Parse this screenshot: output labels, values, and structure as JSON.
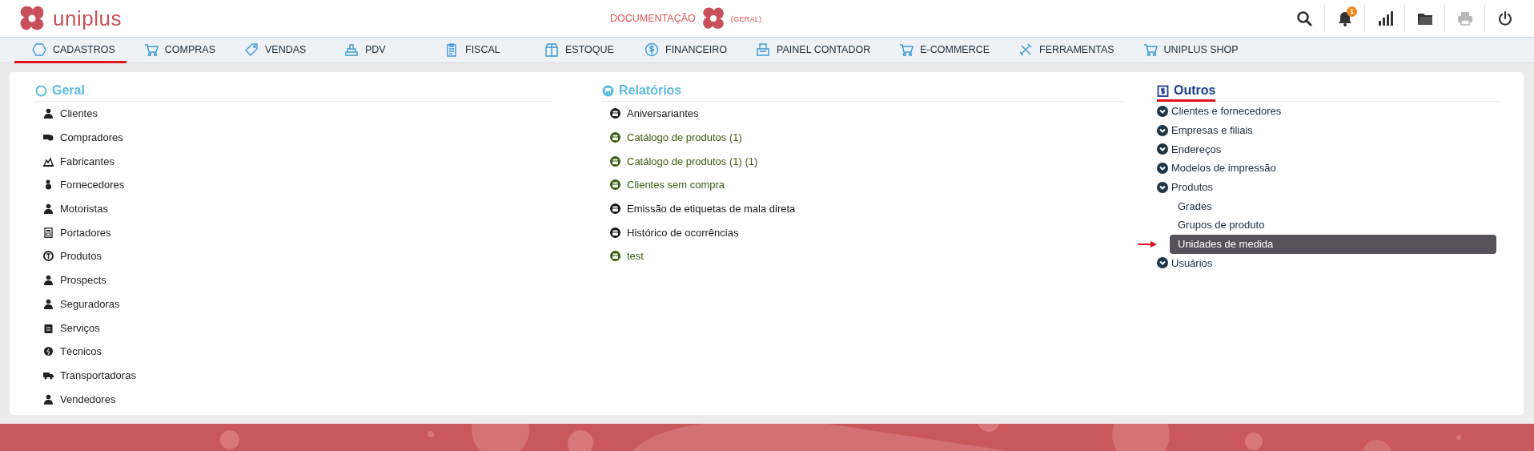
{
  "header": {
    "logo_text": "uniplus",
    "context_label": "DOCUMENTAÇÃO",
    "context_scope": "(GERAL)",
    "toolbar": [
      {
        "kind": "search",
        "disabled": false
      },
      {
        "kind": "notifications",
        "disabled": false,
        "badge": "1"
      },
      {
        "kind": "charts",
        "disabled": false
      },
      {
        "kind": "folder",
        "disabled": false
      },
      {
        "kind": "print",
        "disabled": true
      },
      {
        "kind": "power",
        "disabled": false
      }
    ]
  },
  "menu": [
    {
      "label": "CADASTROS",
      "selected": true
    },
    {
      "label": "COMPRAS",
      "selected": false
    },
    {
      "label": "VENDAS",
      "selected": false
    },
    {
      "label": "PDV",
      "selected": false
    },
    {
      "label": "FISCAL",
      "selected": false
    },
    {
      "label": "ESTOQUE",
      "selected": false
    },
    {
      "label": "FINANCEIRO",
      "selected": false
    },
    {
      "label": "PAINEL CONTADOR",
      "selected": false
    },
    {
      "label": "E-COMMERCE",
      "selected": false
    },
    {
      "label": "FERRAMENTAS",
      "selected": false
    },
    {
      "label": "UNIPLUS SHOP",
      "selected": false
    }
  ],
  "sections": [
    {
      "kind": "geral",
      "title": "Geral",
      "active": false,
      "items": [
        {
          "label": "Clientes"
        },
        {
          "label": "Compradores"
        },
        {
          "label": "Fabricantes"
        },
        {
          "label": "Fornecedores"
        },
        {
          "label": "Motoristas"
        },
        {
          "label": "Portadores"
        },
        {
          "label": "Produtos"
        },
        {
          "label": "Prospects"
        },
        {
          "label": "Seguradoras"
        },
        {
          "label": "Serviços"
        },
        {
          "label": "Técnicos"
        },
        {
          "label": "Transportadoras"
        },
        {
          "label": "Vendedores"
        }
      ]
    },
    {
      "kind": "relatorios",
      "title": "Relatórios",
      "active": false,
      "items": [
        {
          "label": "Aniversariantes",
          "color": "#1a1a1a"
        },
        {
          "label": "Catálogo de produtos (1)",
          "color": "#3e5a12"
        },
        {
          "label": "Catálogo de produtos (1) (1)",
          "color": "#3e5a12"
        },
        {
          "label": "Clientes sem compra",
          "color": "#3e5a12"
        },
        {
          "label": "Emissão de etiquetas de mala direta",
          "color": "#1a1a1a"
        },
        {
          "label": "Histórico de ocorrências",
          "color": "#1a1a1a"
        },
        {
          "label": "test",
          "color": "#3e5a12"
        }
      ]
    },
    {
      "kind": "outros",
      "title": "Outros",
      "active": true,
      "items": [
        {
          "label": "Clientes e fornecedores",
          "selected": false
        },
        {
          "label": "Empresas e filiais",
          "selected": false
        },
        {
          "label": "Endereços",
          "selected": false
        },
        {
          "label": "Modelos de impressão",
          "selected": false
        },
        {
          "label": "Produtos",
          "selected": false,
          "children": [
            {
              "label": "Grades",
              "selected": false
            },
            {
              "label": "Grupos de produto",
              "selected": false
            },
            {
              "label": "Unidades de medida",
              "selected": true
            }
          ]
        },
        {
          "label": "Usuários",
          "selected": false
        }
      ]
    }
  ]
}
